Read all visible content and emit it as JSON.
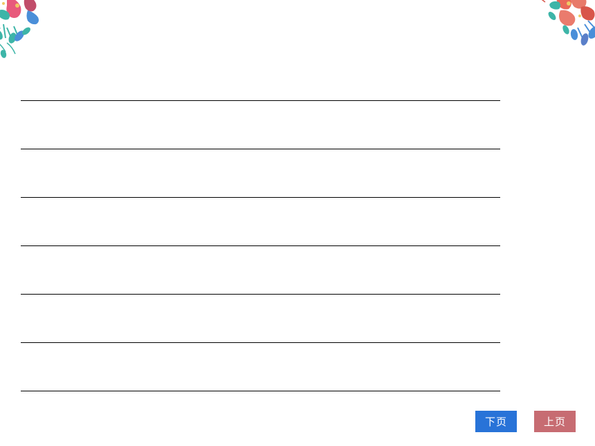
{
  "nav": {
    "next_label": "下页",
    "prev_label": "上页"
  },
  "colors": {
    "next_button": "#2873d8",
    "prev_button": "#c76c72"
  },
  "lines_count": 7
}
